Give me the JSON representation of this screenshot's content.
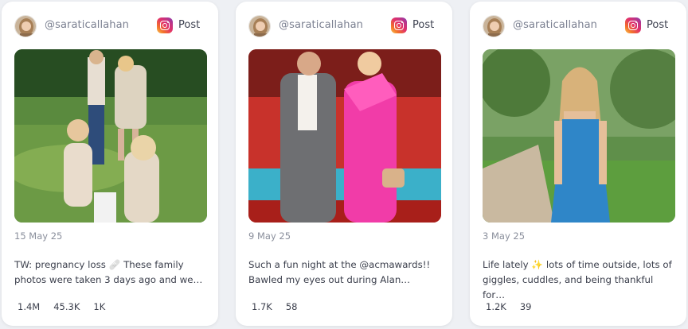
{
  "posts": [
    {
      "username": "@saraticallahan",
      "platform_label": "Post",
      "date": "15 May 25",
      "caption": "TW: pregnancy loss 🩹 These family photos were taken 3 days ago and we…",
      "stats": [
        "1.4M",
        "45.3K",
        "1K"
      ],
      "photo_icon": "family-photo"
    },
    {
      "username": "@saraticallahan",
      "platform_label": "Post",
      "date": "9 May 25",
      "caption": "Such a fun night at the @acmawards!! Bawled my eyes out during Alan…",
      "stats": [
        "1.7K",
        "58"
      ],
      "photo_icon": "red-carpet-photo"
    },
    {
      "username": "@saraticallahan",
      "platform_label": "Post",
      "date": "3 May 25",
      "caption": "Life lately ✨ lots of time outside, lots of giggles, cuddles, and being thankful for…",
      "stats": [
        "1.2K",
        "39"
      ],
      "photo_icon": "outdoor-portrait-photo"
    }
  ],
  "colors": {
    "background": "#eef0f4",
    "card": "#ffffff",
    "username": "#7b8091",
    "date": "#8a8f9c",
    "text": "#3b3f4c"
  }
}
